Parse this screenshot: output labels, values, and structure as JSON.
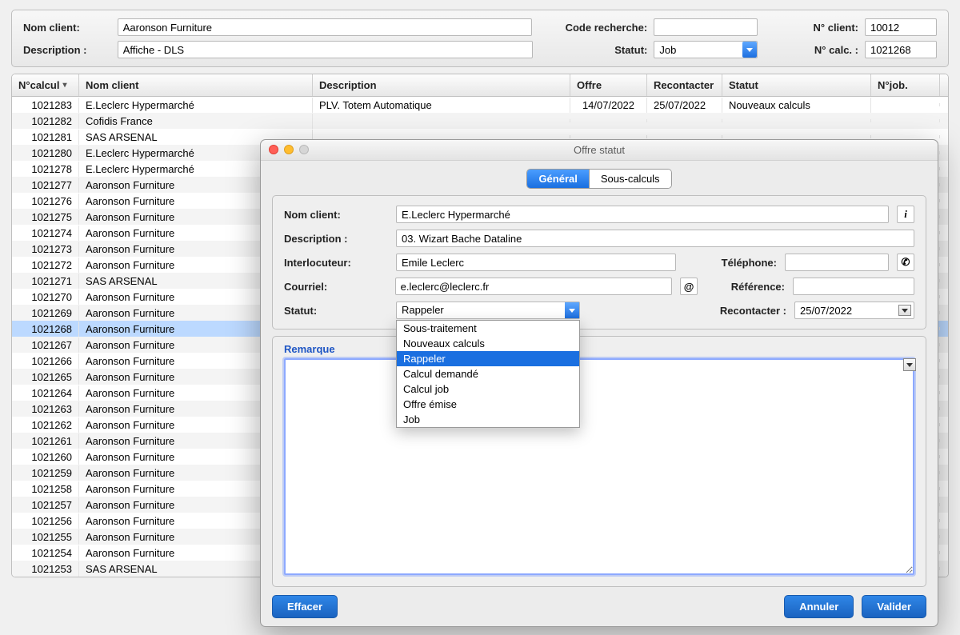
{
  "filter": {
    "labels": {
      "nom_client": "Nom client:",
      "description": "Description :",
      "code_recherche": "Code recherche:",
      "statut": "Statut:",
      "n_client": "N° client:",
      "n_calc": "N° calc. :"
    },
    "values": {
      "nom_client": "Aaronson Furniture",
      "description": "Affiche - DLS",
      "code_recherche": "",
      "statut": "Job",
      "n_client": "10012",
      "n_calc": "1021268"
    }
  },
  "table": {
    "headers": {
      "calc": "N°calcul",
      "nom": "Nom client",
      "desc": "Description",
      "offre": "Offre",
      "recont": "Recontacter",
      "stat": "Statut",
      "job": "N°job."
    },
    "rows": [
      {
        "calc": "1021283",
        "nom": "E.Leclerc Hypermarché",
        "desc": "PLV. Totem Automatique",
        "offre": "14/07/2022",
        "recont": "25/07/2022",
        "stat": "Nouveaux calculs",
        "job": ""
      },
      {
        "calc": "1021282",
        "nom": "Cofidis France",
        "desc": "",
        "offre": "",
        "recont": "",
        "stat": "",
        "job": ""
      },
      {
        "calc": "1021281",
        "nom": "SAS ARSENAL",
        "desc": "",
        "offre": "",
        "recont": "",
        "stat": "",
        "job": ""
      },
      {
        "calc": "1021280",
        "nom": "E.Leclerc Hypermarché",
        "desc": "",
        "offre": "",
        "recont": "",
        "stat": "",
        "job": ""
      },
      {
        "calc": "1021278",
        "nom": "E.Leclerc Hypermarché",
        "desc": "",
        "offre": "",
        "recont": "",
        "stat": "",
        "job": ""
      },
      {
        "calc": "1021277",
        "nom": "Aaronson Furniture",
        "desc": "",
        "offre": "",
        "recont": "",
        "stat": "",
        "job": ""
      },
      {
        "calc": "1021276",
        "nom": "Aaronson Furniture",
        "desc": "",
        "offre": "",
        "recont": "",
        "stat": "",
        "job": ""
      },
      {
        "calc": "1021275",
        "nom": "Aaronson Furniture",
        "desc": "",
        "offre": "",
        "recont": "",
        "stat": "",
        "job": ""
      },
      {
        "calc": "1021274",
        "nom": "Aaronson Furniture",
        "desc": "",
        "offre": "",
        "recont": "",
        "stat": "",
        "job": ""
      },
      {
        "calc": "1021273",
        "nom": "Aaronson Furniture",
        "desc": "",
        "offre": "",
        "recont": "",
        "stat": "",
        "job": ""
      },
      {
        "calc": "1021272",
        "nom": "Aaronson Furniture",
        "desc": "",
        "offre": "",
        "recont": "",
        "stat": "",
        "job": ""
      },
      {
        "calc": "1021271",
        "nom": "SAS ARSENAL",
        "desc": "",
        "offre": "",
        "recont": "",
        "stat": "",
        "job": ""
      },
      {
        "calc": "1021270",
        "nom": "Aaronson Furniture",
        "desc": "",
        "offre": "",
        "recont": "",
        "stat": "",
        "job": ""
      },
      {
        "calc": "1021269",
        "nom": "Aaronson Furniture",
        "desc": "",
        "offre": "",
        "recont": "",
        "stat": "",
        "job": ""
      },
      {
        "calc": "1021268",
        "nom": "Aaronson Furniture",
        "desc": "",
        "offre": "",
        "recont": "",
        "stat": "",
        "job": "",
        "selected": true
      },
      {
        "calc": "1021267",
        "nom": "Aaronson Furniture",
        "desc": "",
        "offre": "",
        "recont": "",
        "stat": "",
        "job": ""
      },
      {
        "calc": "1021266",
        "nom": "Aaronson Furniture",
        "desc": "",
        "offre": "",
        "recont": "",
        "stat": "",
        "job": ""
      },
      {
        "calc": "1021265",
        "nom": "Aaronson Furniture",
        "desc": "",
        "offre": "",
        "recont": "",
        "stat": "",
        "job": ""
      },
      {
        "calc": "1021264",
        "nom": "Aaronson Furniture",
        "desc": "",
        "offre": "",
        "recont": "",
        "stat": "",
        "job": ""
      },
      {
        "calc": "1021263",
        "nom": "Aaronson Furniture",
        "desc": "",
        "offre": "",
        "recont": "",
        "stat": "",
        "job": ""
      },
      {
        "calc": "1021262",
        "nom": "Aaronson Furniture",
        "desc": "",
        "offre": "",
        "recont": "",
        "stat": "",
        "job": ""
      },
      {
        "calc": "1021261",
        "nom": "Aaronson Furniture",
        "desc": "",
        "offre": "",
        "recont": "",
        "stat": "",
        "job": ""
      },
      {
        "calc": "1021260",
        "nom": "Aaronson Furniture",
        "desc": "",
        "offre": "",
        "recont": "",
        "stat": "",
        "job": ""
      },
      {
        "calc": "1021259",
        "nom": "Aaronson Furniture",
        "desc": "",
        "offre": "",
        "recont": "",
        "stat": "",
        "job": ""
      },
      {
        "calc": "1021258",
        "nom": "Aaronson Furniture",
        "desc": "",
        "offre": "",
        "recont": "",
        "stat": "",
        "job": ""
      },
      {
        "calc": "1021257",
        "nom": "Aaronson Furniture",
        "desc": "",
        "offre": "",
        "recont": "",
        "stat": "",
        "job": ""
      },
      {
        "calc": "1021256",
        "nom": "Aaronson Furniture",
        "desc": "",
        "offre": "",
        "recont": "",
        "stat": "",
        "job": ""
      },
      {
        "calc": "1021255",
        "nom": "Aaronson Furniture",
        "desc": "",
        "offre": "",
        "recont": "",
        "stat": "",
        "job": ""
      },
      {
        "calc": "1021254",
        "nom": "Aaronson Furniture",
        "desc": "",
        "offre": "",
        "recont": "",
        "stat": "",
        "job": ""
      },
      {
        "calc": "1021253",
        "nom": "SAS ARSENAL",
        "desc": "",
        "offre": "",
        "recont": "",
        "stat": "",
        "job": ""
      }
    ]
  },
  "modal": {
    "title": "Offre statut",
    "tabs": {
      "general": "Général",
      "sous": "Sous-calculs"
    },
    "labels": {
      "nom_client": "Nom client:",
      "description": "Description :",
      "interlocuteur": "Interlocuteur:",
      "courriel": "Courriel:",
      "statut": "Statut:",
      "telephone": "Téléphone:",
      "reference": "Référence:",
      "recontacter": "Recontacter :",
      "remarque": "Remarque"
    },
    "values": {
      "nom_client": "E.Leclerc Hypermarché",
      "description": "03. Wizart Bache Dataline",
      "interlocuteur": "Emile Leclerc",
      "courriel": "e.leclerc@leclerc.fr",
      "telephone": "",
      "reference": "",
      "statut": "Rappeler",
      "recontacter": "25/07/2022",
      "remarque": ""
    },
    "statut_options": [
      "Sous-traitement",
      "Nouveaux calculs",
      "Rappeler",
      "Calcul demandé",
      "Calcul job",
      "Offre émise",
      "Job"
    ],
    "statut_selected_index": 2,
    "buttons": {
      "effacer": "Effacer",
      "annuler": "Annuler",
      "valider": "Valider"
    },
    "icons": {
      "info": "i",
      "at": "@",
      "phone": "✆"
    }
  }
}
